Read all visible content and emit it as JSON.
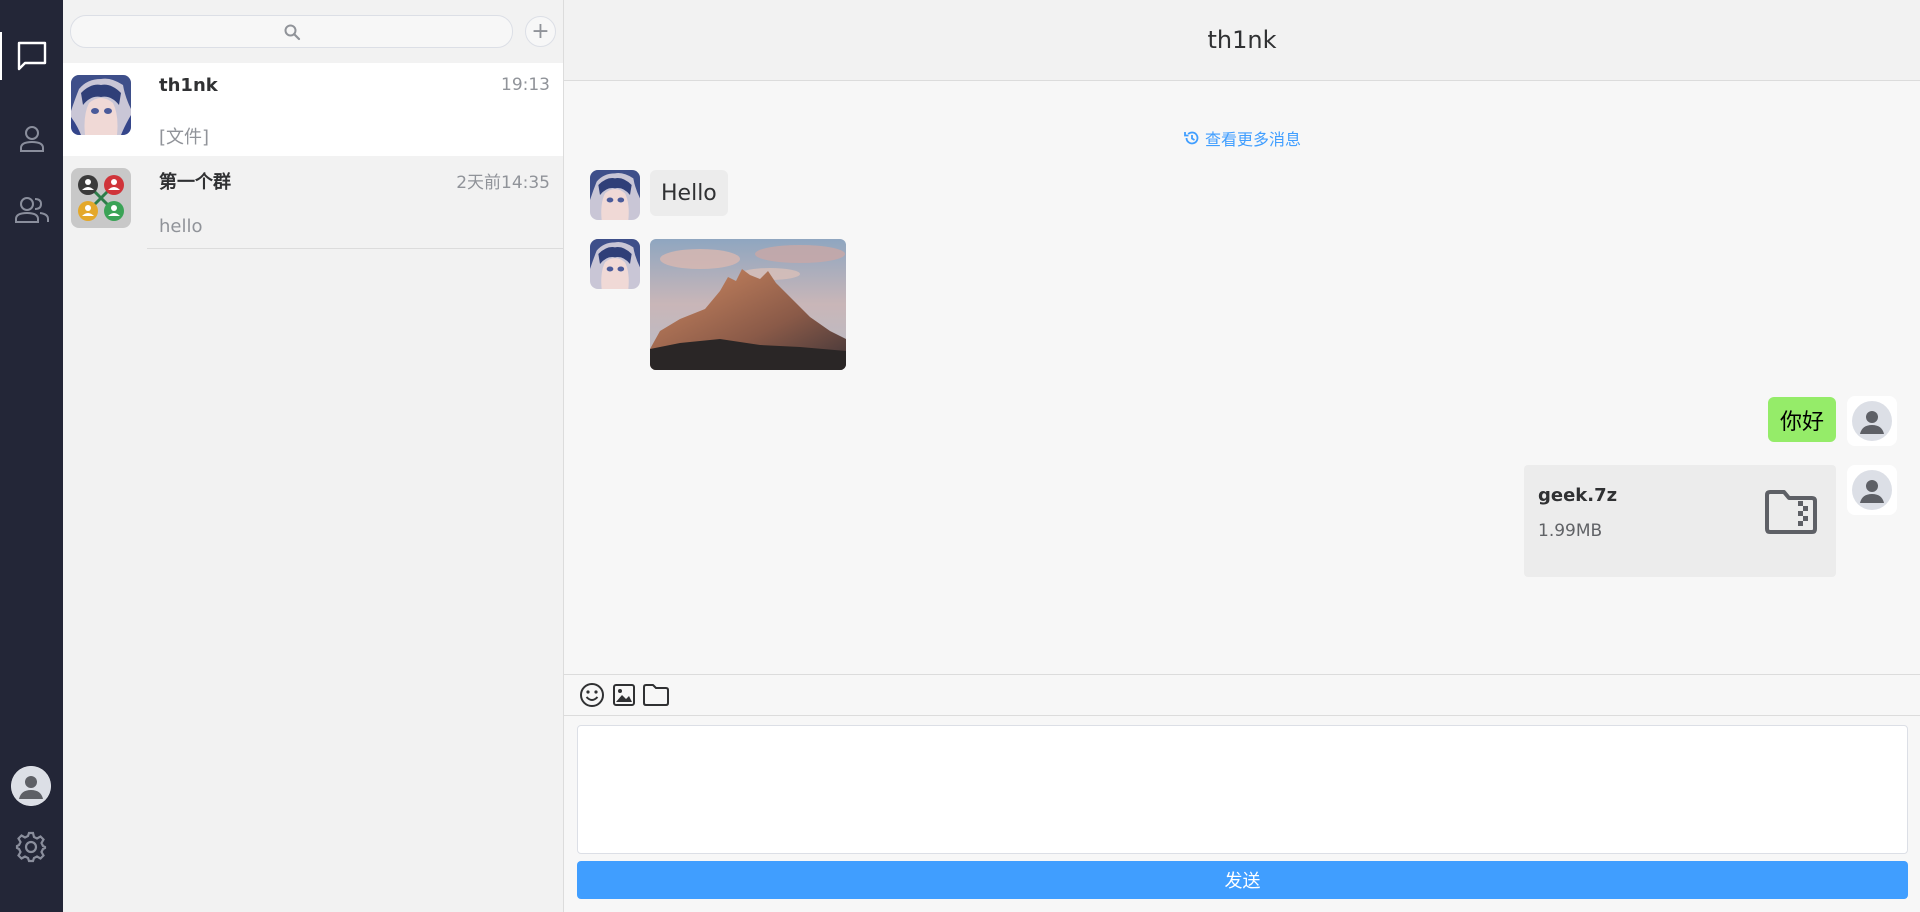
{
  "app": {
    "nav": [
      {
        "icon": "chat-bubble-icon",
        "active": true
      },
      {
        "icon": "contact-person-icon",
        "active": false
      },
      {
        "icon": "group-people-icon",
        "active": false
      }
    ],
    "bottom_icons": [
      "user-avatar-icon",
      "gear-icon"
    ]
  },
  "sidebar": {
    "search": {
      "placeholder": "",
      "icon": "search-icon"
    },
    "add_label": "+",
    "conversations": [
      {
        "name": "th1nk",
        "time": "19:13",
        "preview": "[文件]",
        "active": true
      },
      {
        "name": "第一个群",
        "time": "2天前14:35",
        "preview": "hello",
        "active": false
      }
    ]
  },
  "chat": {
    "title": "th1nk",
    "load_more": "查看更多消息",
    "messages": [
      {
        "from": "other",
        "type": "text",
        "text": "Hello"
      },
      {
        "from": "other",
        "type": "image",
        "alt": "mountain photo"
      },
      {
        "from": "self",
        "type": "text",
        "text": "你好"
      },
      {
        "from": "self",
        "type": "file",
        "file_name": "geek.7z",
        "file_size": "1.99MB"
      }
    ],
    "toolbar": [
      "emoji-icon",
      "image-icon",
      "folder-icon"
    ],
    "send_label": "发送"
  },
  "colors": {
    "rail": "#232637",
    "accent": "#409eff",
    "self_bubble": "#95ec69",
    "other_bubble": "#ececec"
  }
}
